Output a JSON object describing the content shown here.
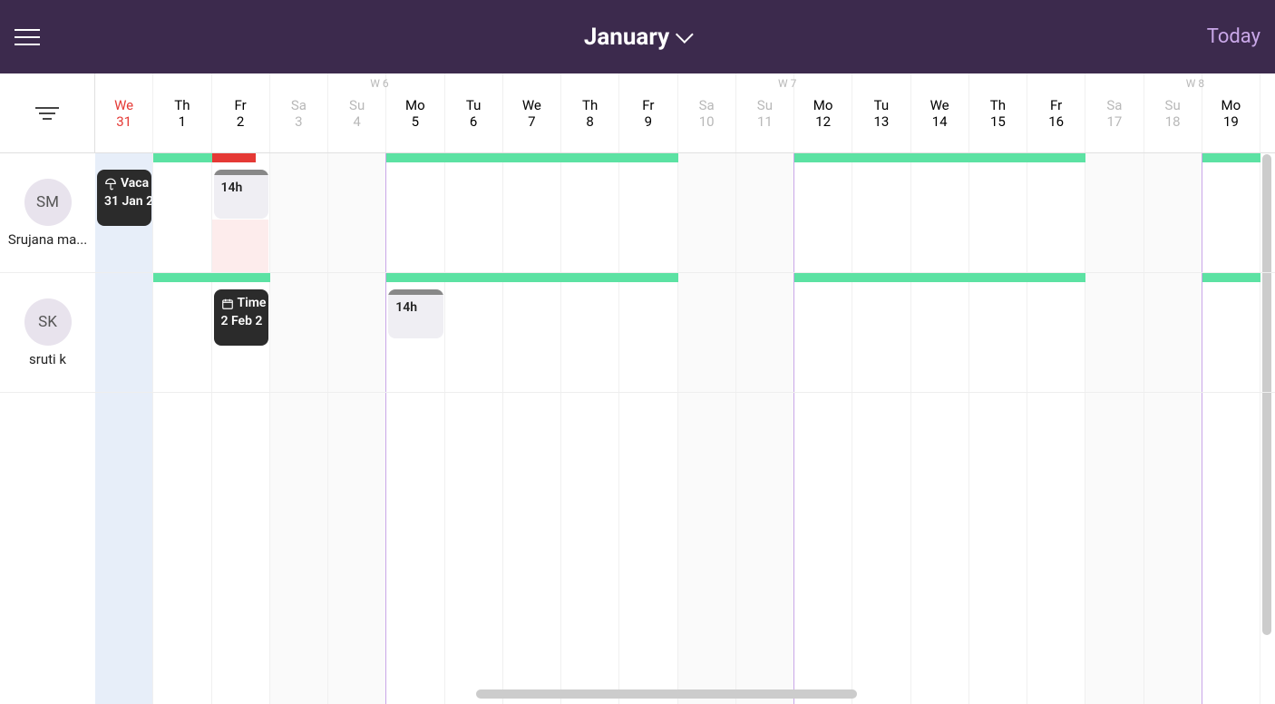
{
  "header": {
    "month": "January",
    "today_label": "Today"
  },
  "week_labels": [
    {
      "text": "W 6",
      "colIndex": 5
    },
    {
      "text": "W 7",
      "colIndex": 12
    },
    {
      "text": "W 8",
      "colIndex": 19
    }
  ],
  "days": [
    {
      "dow": "We",
      "num": "31",
      "today": true
    },
    {
      "dow": "Th",
      "num": "1"
    },
    {
      "dow": "Fr",
      "num": "2"
    },
    {
      "dow": "Sa",
      "num": "3",
      "weekend": true
    },
    {
      "dow": "Su",
      "num": "4",
      "weekend": true
    },
    {
      "dow": "Mo",
      "num": "5"
    },
    {
      "dow": "Tu",
      "num": "6"
    },
    {
      "dow": "We",
      "num": "7"
    },
    {
      "dow": "Th",
      "num": "8"
    },
    {
      "dow": "Fr",
      "num": "9"
    },
    {
      "dow": "Sa",
      "num": "10",
      "weekend": true
    },
    {
      "dow": "Su",
      "num": "11",
      "weekend": true
    },
    {
      "dow": "Mo",
      "num": "12"
    },
    {
      "dow": "Tu",
      "num": "13"
    },
    {
      "dow": "We",
      "num": "14"
    },
    {
      "dow": "Th",
      "num": "15"
    },
    {
      "dow": "Fr",
      "num": "16"
    },
    {
      "dow": "Sa",
      "num": "17",
      "weekend": true
    },
    {
      "dow": "Su",
      "num": "18",
      "weekend": true
    },
    {
      "dow": "Mo",
      "num": "19"
    }
  ],
  "people": [
    {
      "initials": "SM",
      "name": "Srujana ma..."
    },
    {
      "initials": "SK",
      "name": "sruti k"
    }
  ],
  "cards": {
    "sm_vacation_title": "Vaca",
    "sm_vacation_sub": "31 Jan 2",
    "sm_14h": "14h",
    "sk_time_title": "Time",
    "sk_time_sub": "2 Feb 2",
    "sk_14h": "14h"
  }
}
